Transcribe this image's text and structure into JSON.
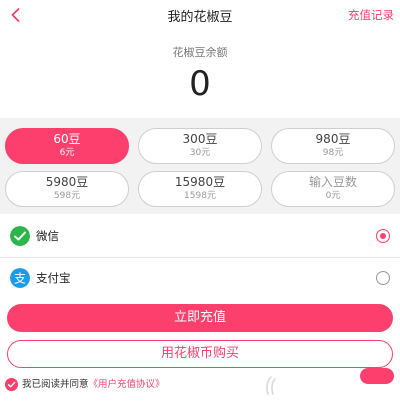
{
  "header": {
    "back_icon": "chevron-left-icon",
    "title": "我的花椒豆",
    "history_link": "充值记录"
  },
  "balance": {
    "label": "花椒豆余额",
    "value": "0"
  },
  "options": [
    {
      "amount": "60豆",
      "price": "6元",
      "selected": true
    },
    {
      "amount": "300豆",
      "price": "30元",
      "selected": false
    },
    {
      "amount": "980豆",
      "price": "98元",
      "selected": false
    },
    {
      "amount": "5980豆",
      "price": "598元",
      "selected": false
    },
    {
      "amount": "15980豆",
      "price": "1598元",
      "selected": false
    },
    {
      "amount": "输入豆数",
      "price": "0元",
      "selected": false
    }
  ],
  "payment_methods": [
    {
      "label": "微信",
      "icon": "wechat-pay-icon",
      "selected": true
    },
    {
      "label": "支付宝",
      "icon": "alipay-icon",
      "selected": false
    }
  ],
  "buttons": {
    "recharge": "立即充值",
    "buy_with_coins": "用花椒币购买"
  },
  "agreement": {
    "text": "我已阅读并同意",
    "link": "《用户充值协议》",
    "checked": true
  },
  "colors": {
    "accent": "#fd3f6d",
    "wechat": "#2bb54b",
    "alipay": "#1c9be8"
  }
}
